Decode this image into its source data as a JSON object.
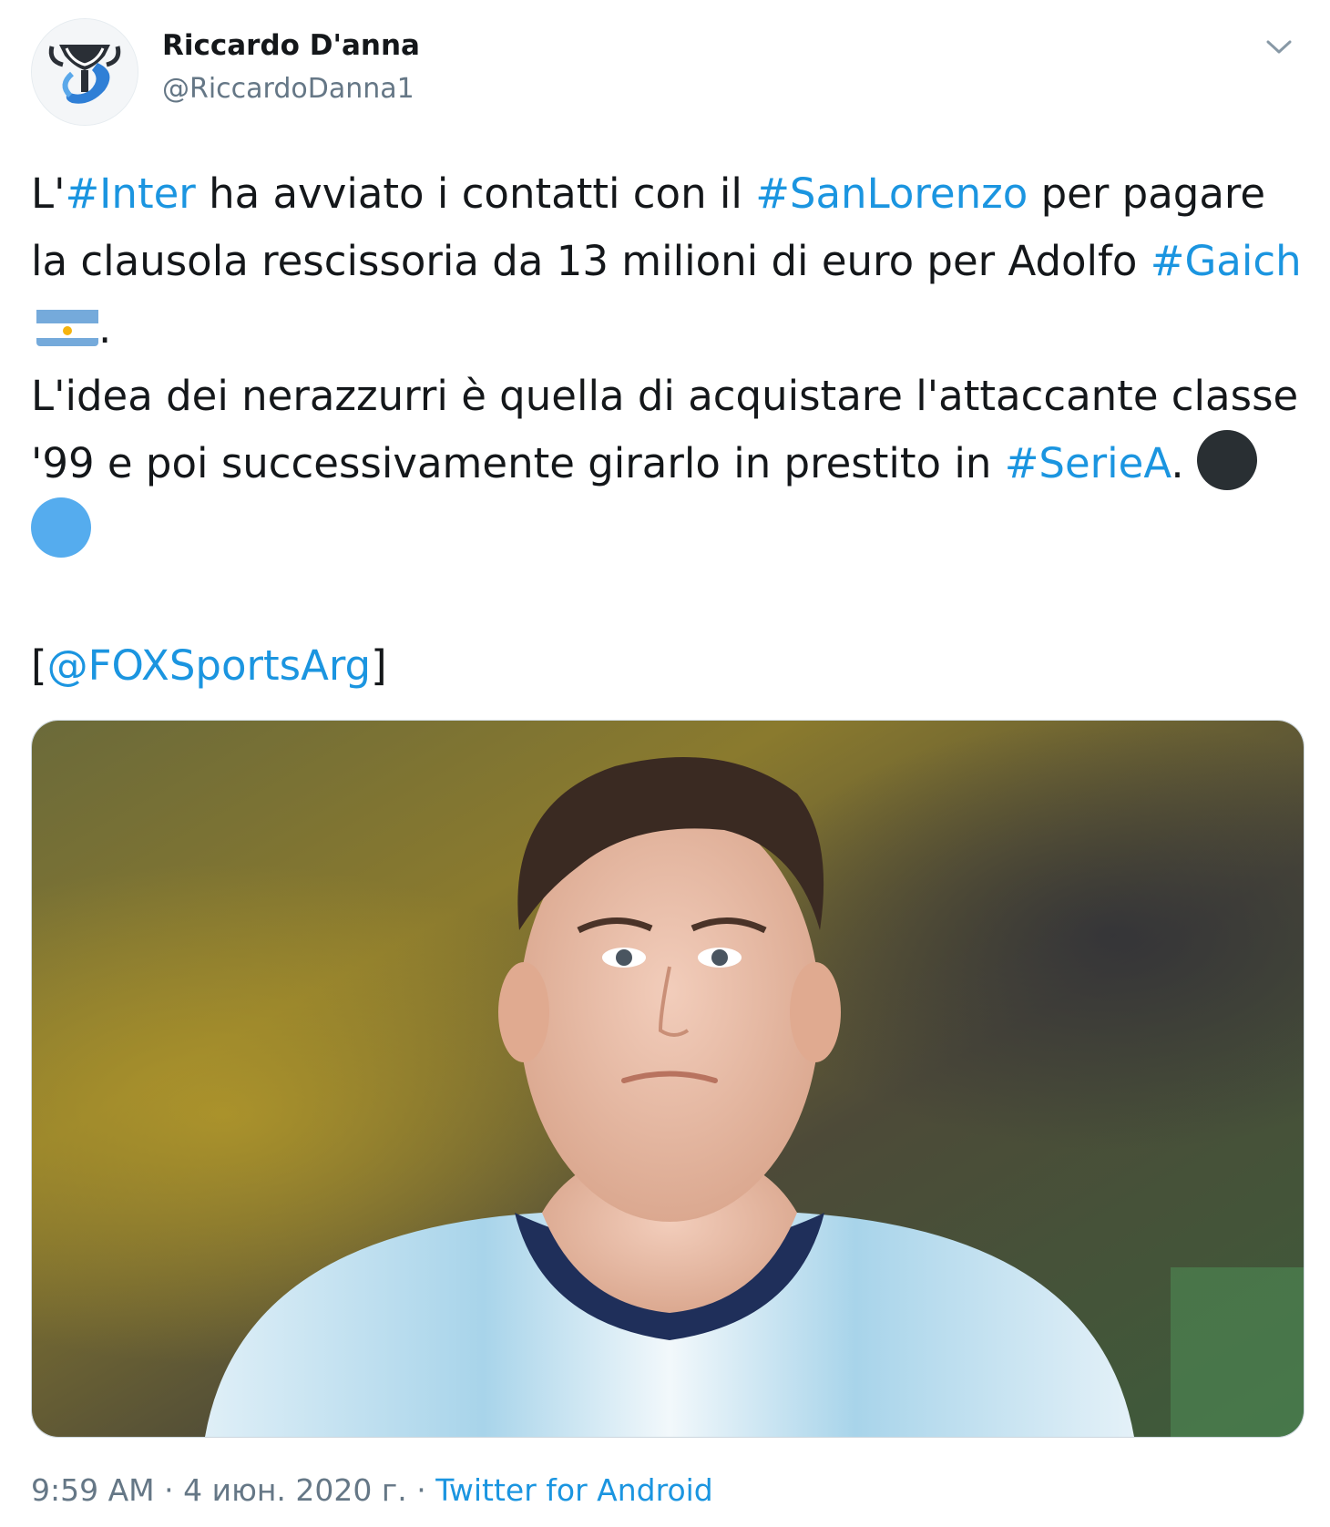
{
  "user": {
    "name": "Riccardo D'anna",
    "handle": "@RiccardoDanna1"
  },
  "text": {
    "p1": {
      "t1": "L'",
      "tag_inter": "#Inter",
      "t2": " ha avviato i contatti con il ",
      "tag_sanlorenzo": "#SanLorenzo",
      "t3": " per pagare la clausola rescissoria da 13 milioni di euro per Adolfo ",
      "tag_gaich": "#Gaich",
      "t4": "."
    },
    "p2": {
      "t1": "L'idea dei nerazzurri è quella di acquistare l'attaccante classe '99 e poi successivamente girarlo in prestito in ",
      "tag_seriea": "#SerieA",
      "t2": ". "
    },
    "p3": {
      "open": "[",
      "mention": "@FOXSportsArg",
      "close": "]"
    },
    "emoji": {
      "flag": "argentina-flag",
      "dot1_color": "#292f33",
      "dot2_color": "#55acee"
    }
  },
  "meta": {
    "time": "9:59 AM",
    "sep1": " · ",
    "date": "4 июн. 2020 г.",
    "sep2": " · ",
    "source": "Twitter for Android"
  },
  "colors": {
    "link": "#1b95e0",
    "muted": "#657786",
    "text": "#14171a"
  }
}
